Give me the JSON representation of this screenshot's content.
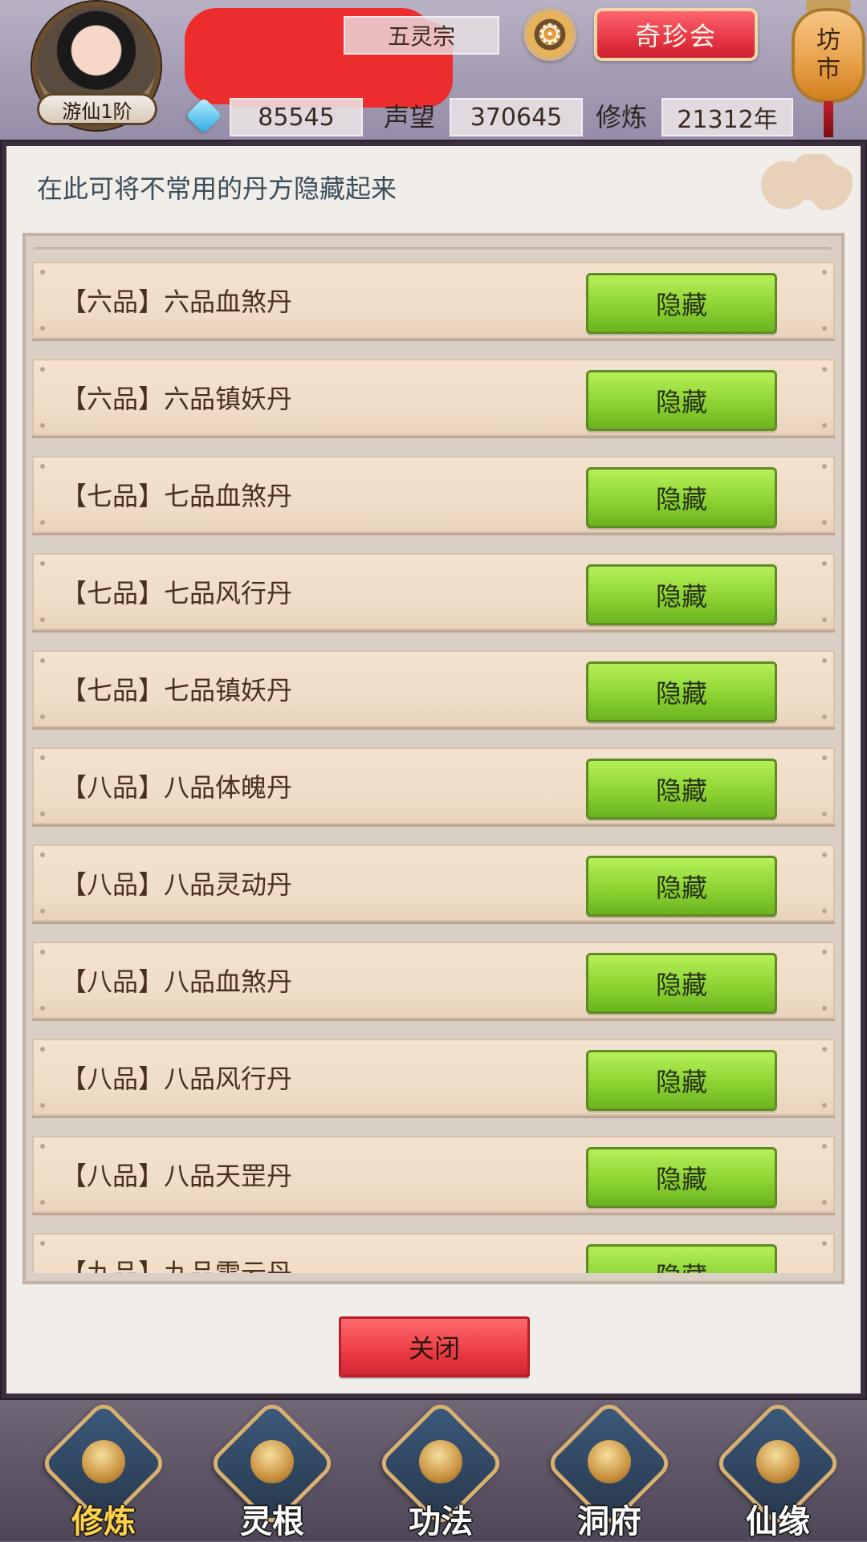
{
  "header": {
    "avatar_rank": "游仙1阶",
    "sect_name": "五灵宗",
    "treasure_button": "奇珍会",
    "market_button": [
      "坊",
      "市"
    ],
    "stats": {
      "gems": "85545",
      "reputation_label": "声望",
      "reputation_value": "370645",
      "cultivation_label": "修炼",
      "cultivation_value": "21312年"
    }
  },
  "modal": {
    "title": "在此可将不常用的丹方隐藏起来",
    "close_button": "关闭",
    "items": [
      {
        "label": "【六品】六品血煞丹",
        "action": "隐藏"
      },
      {
        "label": "【六品】六品镇妖丹",
        "action": "隐藏"
      },
      {
        "label": "【七品】七品血煞丹",
        "action": "隐藏"
      },
      {
        "label": "【七品】七品风行丹",
        "action": "隐藏"
      },
      {
        "label": "【七品】七品镇妖丹",
        "action": "隐藏"
      },
      {
        "label": "【八品】八品体魄丹",
        "action": "隐藏"
      },
      {
        "label": "【八品】八品灵动丹",
        "action": "隐藏"
      },
      {
        "label": "【八品】八品血煞丹",
        "action": "隐藏"
      },
      {
        "label": "【八品】八品风行丹",
        "action": "隐藏"
      },
      {
        "label": "【八品】八品天罡丹",
        "action": "隐藏"
      },
      {
        "label": "【九品】九品雷云丹",
        "action": "隐藏"
      }
    ]
  },
  "bottom_nav": {
    "items": [
      {
        "label": "修炼",
        "active": true
      },
      {
        "label": "灵根",
        "active": false
      },
      {
        "label": "功法",
        "active": false
      },
      {
        "label": "洞府",
        "active": false
      },
      {
        "label": "仙缘",
        "active": false
      }
    ]
  }
}
